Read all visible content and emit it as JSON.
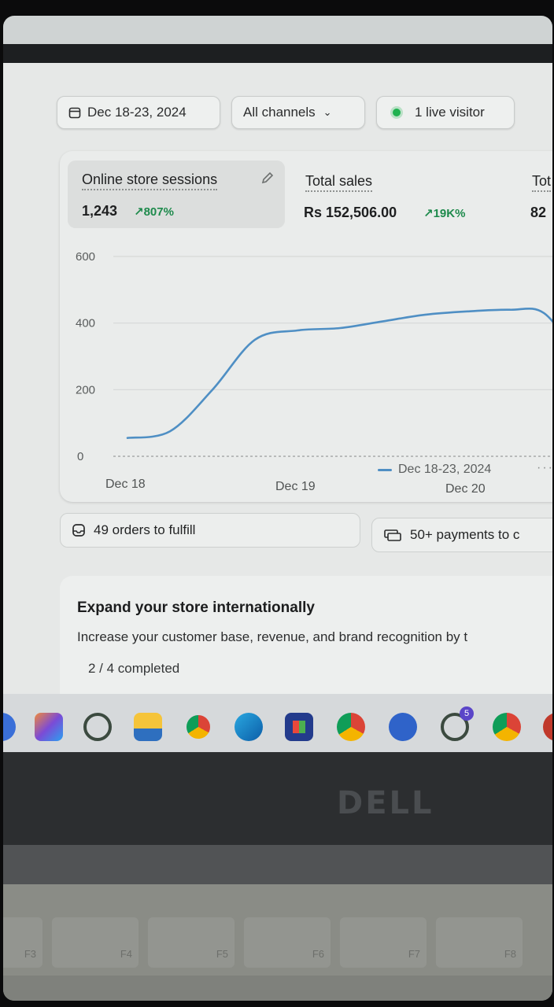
{
  "toolbar": {
    "date_range": "Dec 18-23, 2024",
    "channels": "All channels",
    "live_visitors": "1 live visitor"
  },
  "metrics": [
    {
      "label": "Online store sessions",
      "value": "1,243",
      "change": "807%"
    },
    {
      "label": "Total sales",
      "value": "Rs 152,506.00",
      "change": "19K%"
    },
    {
      "label": "Tot",
      "value": "82"
    }
  ],
  "chart_data": {
    "type": "line",
    "x": [
      "Dec 18",
      "Dec 19",
      "Dec 20"
    ],
    "y_ticks": [
      0,
      200,
      400,
      600
    ],
    "ylim": [
      0,
      600
    ],
    "series": [
      {
        "name": "Dec 18-23, 2024",
        "color": "#4f8fc4",
        "points": [
          {
            "x": 0.0,
            "y": 55
          },
          {
            "x": 0.25,
            "y": 75
          },
          {
            "x": 0.5,
            "y": 200
          },
          {
            "x": 0.75,
            "y": 350
          },
          {
            "x": 1.0,
            "y": 378
          },
          {
            "x": 1.25,
            "y": 385
          },
          {
            "x": 1.5,
            "y": 405
          },
          {
            "x": 1.75,
            "y": 425
          },
          {
            "x": 2.0,
            "y": 435
          },
          {
            "x": 2.25,
            "y": 440
          },
          {
            "x": 2.45,
            "y": 430
          },
          {
            "x": 2.65,
            "y": 300
          }
        ]
      }
    ],
    "grid": true,
    "legend": "bottom"
  },
  "actions": {
    "orders": "49 orders to fulfill",
    "payments": "50+ payments to c"
  },
  "expand": {
    "title": "Expand your store internationally",
    "text": "Increase your customer base, revenue, and brand recognition by t",
    "progress": "2 / 4 completed"
  },
  "taskbar_badge": "5",
  "brand": "DELL",
  "keys": [
    "F3",
    "F4",
    "F5",
    "F6",
    "F7",
    "F8"
  ],
  "colors": {
    "accent_line": "#4f8fc4",
    "positive": "#1e8a4c",
    "live_dot": "#1fb250"
  }
}
